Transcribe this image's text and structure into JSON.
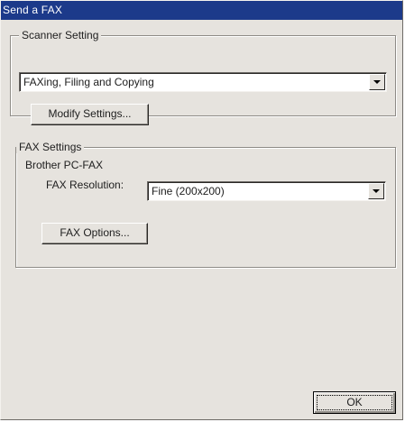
{
  "window": {
    "title": "Send a FAX"
  },
  "scanner_group": {
    "label": "Scanner Setting",
    "mode_selected": "FAXing, Filing and Copying",
    "modify_button": "Modify Settings..."
  },
  "fax_group": {
    "label": "FAX Settings",
    "driver_name": "Brother PC-FAX",
    "resolution_label": "FAX Resolution:",
    "resolution_selected": "Fine (200x200)",
    "options_button": "FAX Options..."
  },
  "footer": {
    "ok_button": "OK"
  },
  "colors": {
    "titlebar": "#1c3a8a",
    "dialog_background": "#e6e3de"
  }
}
